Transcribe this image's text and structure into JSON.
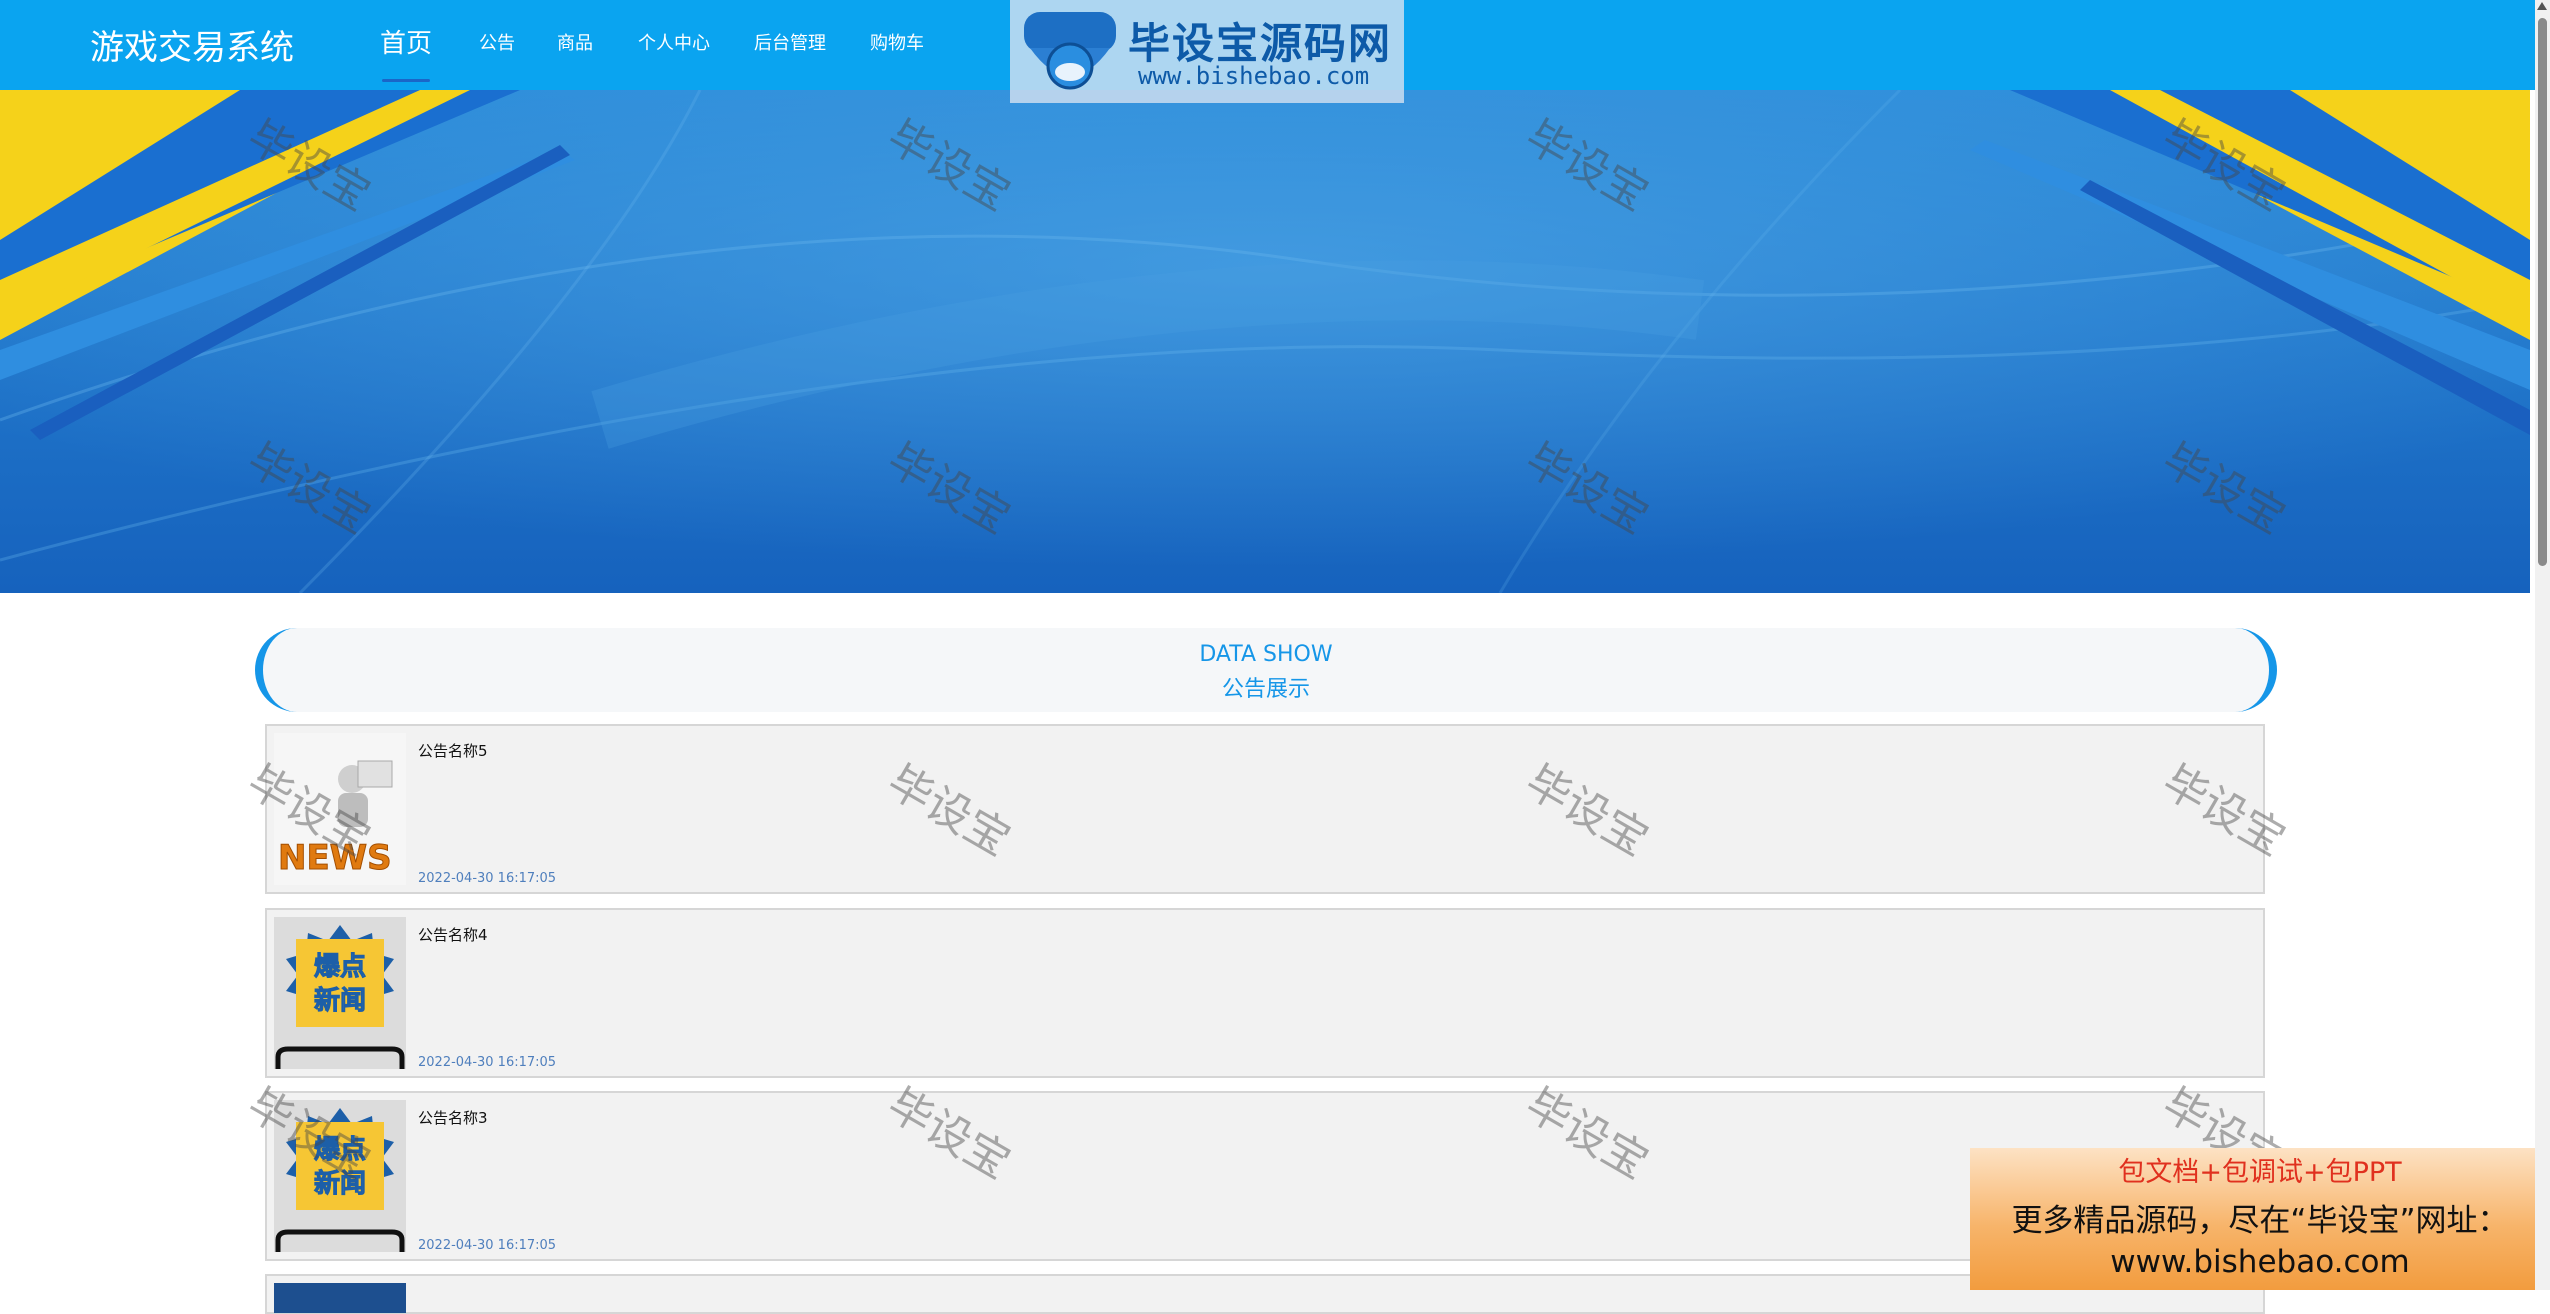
{
  "header": {
    "site_title": "游戏交易系统",
    "nav": [
      {
        "label": "首页",
        "active": true
      },
      {
        "label": "公告",
        "active": false
      },
      {
        "label": "商品",
        "active": false
      },
      {
        "label": "个人中心",
        "active": false
      },
      {
        "label": "后台管理",
        "active": false
      },
      {
        "label": "购物车",
        "active": false
      }
    ]
  },
  "logo_badge": {
    "title": "毕设宝源码网",
    "url": "www.bishebao.com",
    "emblem_text": "毕设宝"
  },
  "banner": {
    "slide_count": 3,
    "active_slide": 1
  },
  "section": {
    "title_en": "DATA SHOW",
    "title_cn": "公告展示"
  },
  "notices": [
    {
      "title": "公告名称5",
      "time": "2022-04-30 16:17:05",
      "thumb": "news-3d-figure",
      "thumb_text": "NEWS"
    },
    {
      "title": "公告名称4",
      "time": "2022-04-30 16:17:05",
      "thumb": "breaking-news-phone",
      "thumb_text": "爆点新闻"
    },
    {
      "title": "公告名称3",
      "time": "2022-04-30 16:17:05",
      "thumb": "breaking-news-phone",
      "thumb_text": "爆点新闻"
    }
  ],
  "watermark_text": "毕设宝",
  "ad": {
    "line1": "包文档+包调试+包PPT",
    "line2": "更多精品源码，尽在“毕设宝”网址：",
    "line3": "www.bishebao.com"
  },
  "colors": {
    "header_bg": "#0aa4f0",
    "accent": "#1596e8",
    "banner_blue": "#1d7fd0",
    "banner_yellow": "#f5d21a"
  }
}
